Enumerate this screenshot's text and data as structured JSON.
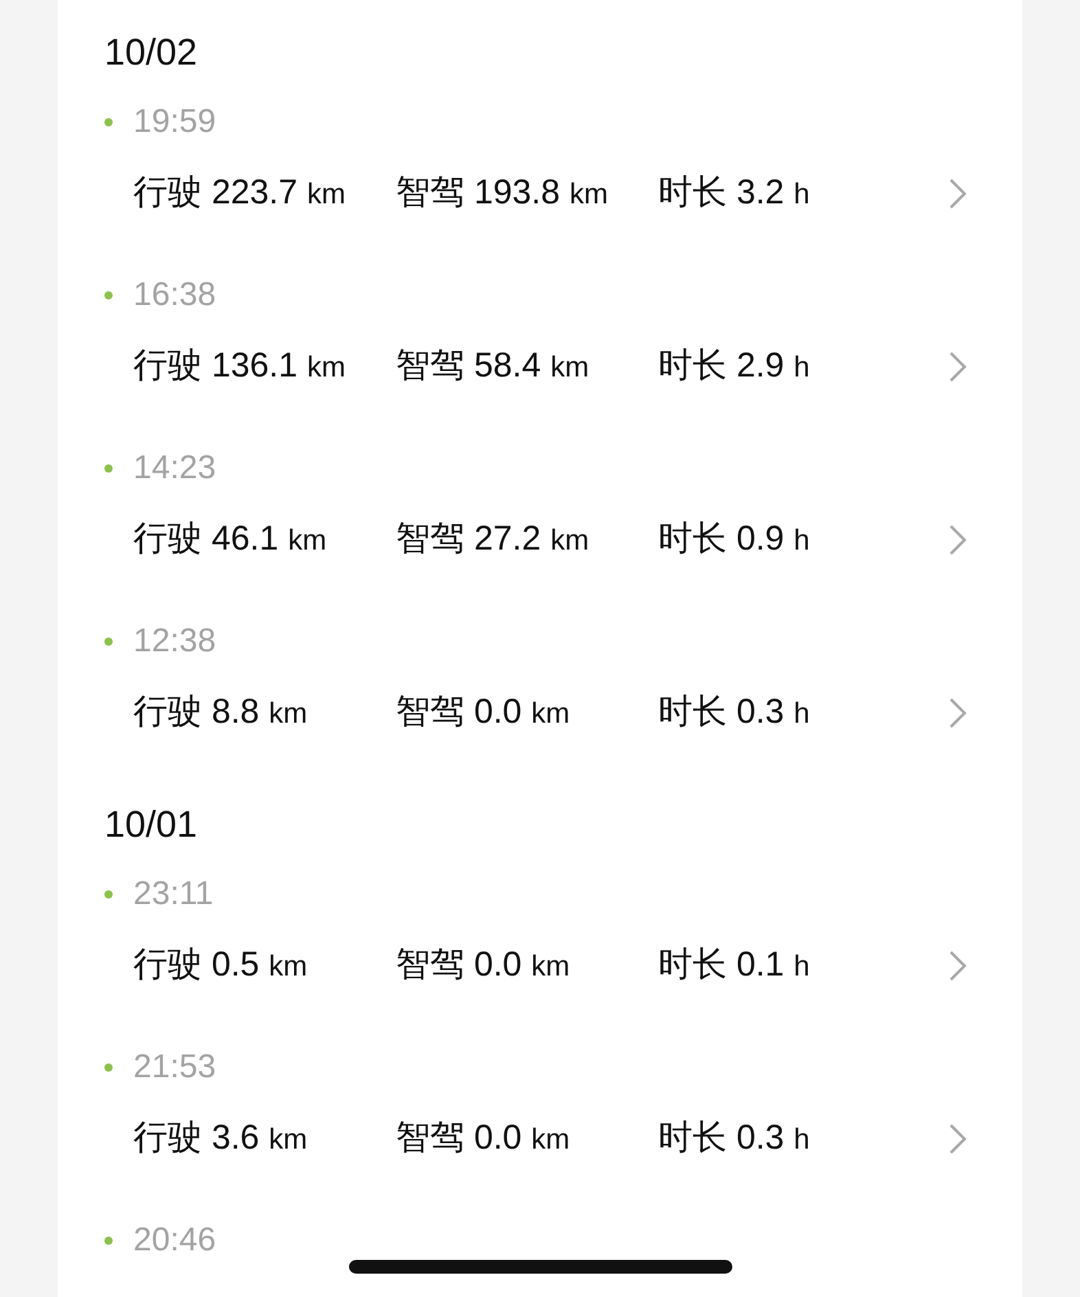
{
  "days": [
    {
      "date": "10/02",
      "trips": [
        {
          "time": "19:59",
          "stats": [
            {
              "label": "行驶",
              "value": "223.7",
              "unit": "km"
            },
            {
              "label": "智驾",
              "value": "193.8",
              "unit": "km"
            },
            {
              "label": "时长",
              "value": "3.2",
              "unit": "h"
            }
          ]
        },
        {
          "time": "16:38",
          "stats": [
            {
              "label": "行驶",
              "value": "136.1",
              "unit": "km"
            },
            {
              "label": "智驾",
              "value": "58.4",
              "unit": "km"
            },
            {
              "label": "时长",
              "value": "2.9",
              "unit": "h"
            }
          ]
        },
        {
          "time": "14:23",
          "stats": [
            {
              "label": "行驶",
              "value": "46.1",
              "unit": "km"
            },
            {
              "label": "智驾",
              "value": "27.2",
              "unit": "km"
            },
            {
              "label": "时长",
              "value": "0.9",
              "unit": "h"
            }
          ]
        },
        {
          "time": "12:38",
          "stats": [
            {
              "label": "行驶",
              "value": "8.8",
              "unit": "km"
            },
            {
              "label": "智驾",
              "value": "0.0",
              "unit": "km"
            },
            {
              "label": "时长",
              "value": "0.3",
              "unit": "h"
            }
          ]
        }
      ]
    },
    {
      "date": "10/01",
      "trips": [
        {
          "time": "23:11",
          "stats": [
            {
              "label": "行驶",
              "value": "0.5",
              "unit": "km"
            },
            {
              "label": "智驾",
              "value": "0.0",
              "unit": "km"
            },
            {
              "label": "时长",
              "value": "0.1",
              "unit": "h"
            }
          ]
        },
        {
          "time": "21:53",
          "stats": [
            {
              "label": "行驶",
              "value": "3.6",
              "unit": "km"
            },
            {
              "label": "智驾",
              "value": "0.0",
              "unit": "km"
            },
            {
              "label": "时长",
              "value": "0.3",
              "unit": "h"
            }
          ]
        },
        {
          "time": "20:46"
        }
      ]
    }
  ]
}
